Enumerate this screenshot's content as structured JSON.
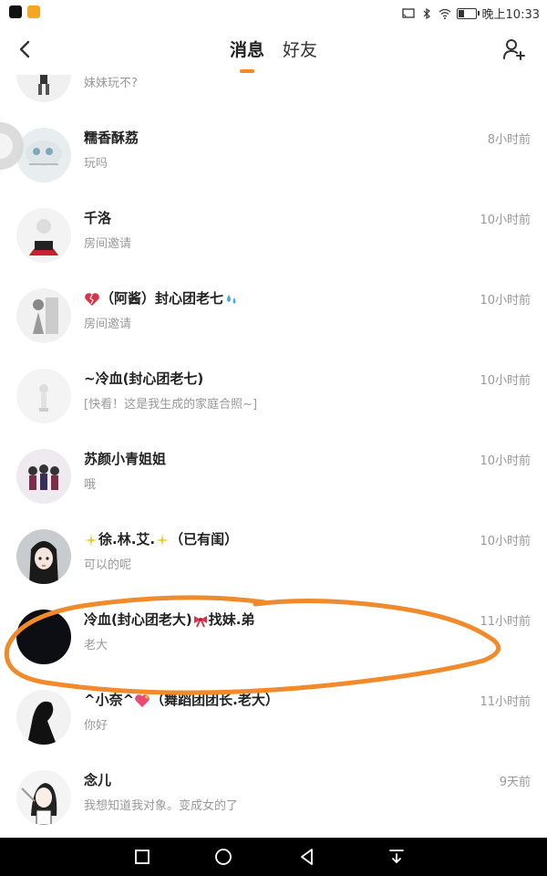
{
  "status_bar": {
    "time": "晚上10:33",
    "icons": [
      "tiktok-icon",
      "app-badge-icon",
      "cast-icon",
      "bluetooth-icon",
      "wifi-icon",
      "battery-icon"
    ]
  },
  "header": {
    "tabs": [
      {
        "label": "消息",
        "active": true
      },
      {
        "label": "好友",
        "active": false
      }
    ]
  },
  "accent_color": "#f08a2a",
  "conversations": [
    {
      "name": "",
      "preview": "妹妹玩不?",
      "time": ""
    },
    {
      "name": "糯香酥荔",
      "preview": "玩吗",
      "time": "8小时前"
    },
    {
      "name": "千洛",
      "preview": "房间邀请",
      "time": "10小时前"
    },
    {
      "name": "（阿酱）封心团老七",
      "preview": "房间邀请",
      "time": "10小时前"
    },
    {
      "name": "~冷血(封心团老七)",
      "preview": "[快看！这是我生成的家庭合照~]",
      "time": "10小时前"
    },
    {
      "name": "苏颜小青姐姐",
      "preview": "哦",
      "time": "10小时前"
    },
    {
      "name": "徐.林.艾.",
      "name_suffix": "（已有闺）",
      "preview": "可以的呢",
      "time": "10小时前"
    },
    {
      "name": "冷血(封心团老大)",
      "name_suffix": "找妹.弟",
      "preview": "老大",
      "time": "11小时前"
    },
    {
      "name": "^小奈^",
      "name_suffix": "（舞蹈团团长.老大）",
      "preview": "你好",
      "time": "11小时前"
    },
    {
      "name": "念儿",
      "preview": "我想知道我对象。变成女的了",
      "time": "9天前"
    }
  ]
}
